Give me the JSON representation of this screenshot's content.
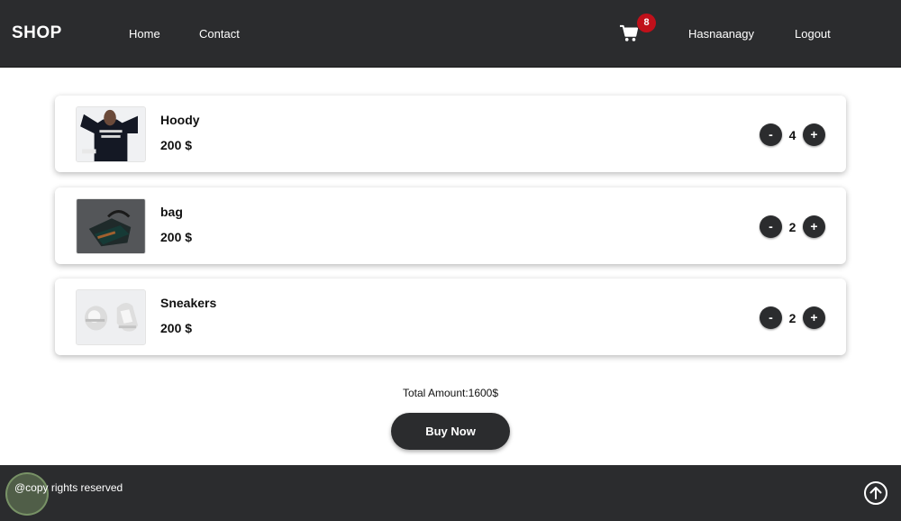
{
  "navbar": {
    "brand": "SHOP",
    "links": [
      "Home",
      "Contact"
    ],
    "cart_icon": "cart-icon",
    "cart_count": "8",
    "username": "Hasnaanagy",
    "logout": "Logout"
  },
  "cart": {
    "items": [
      {
        "name": "Hoody",
        "price": "200 $",
        "quantity": "4",
        "image": "hoodie-photo"
      },
      {
        "name": "bag",
        "price": "200 $",
        "quantity": "2",
        "image": "bag-photo"
      },
      {
        "name": "Sneakers",
        "price": "200 $",
        "quantity": "2",
        "image": "sneakers-photo"
      }
    ],
    "decrement_label": "-",
    "increment_label": "+"
  },
  "summary": {
    "total": "Total Amount:1600$",
    "buy_label": "Buy Now"
  },
  "footer": {
    "copyright": "@copy rights reserved",
    "scroll_icon": "arrow-up-icon"
  },
  "colors": {
    "navbar": "#2b2c2e",
    "badge": "#c0101a",
    "background": "#ffffff"
  }
}
